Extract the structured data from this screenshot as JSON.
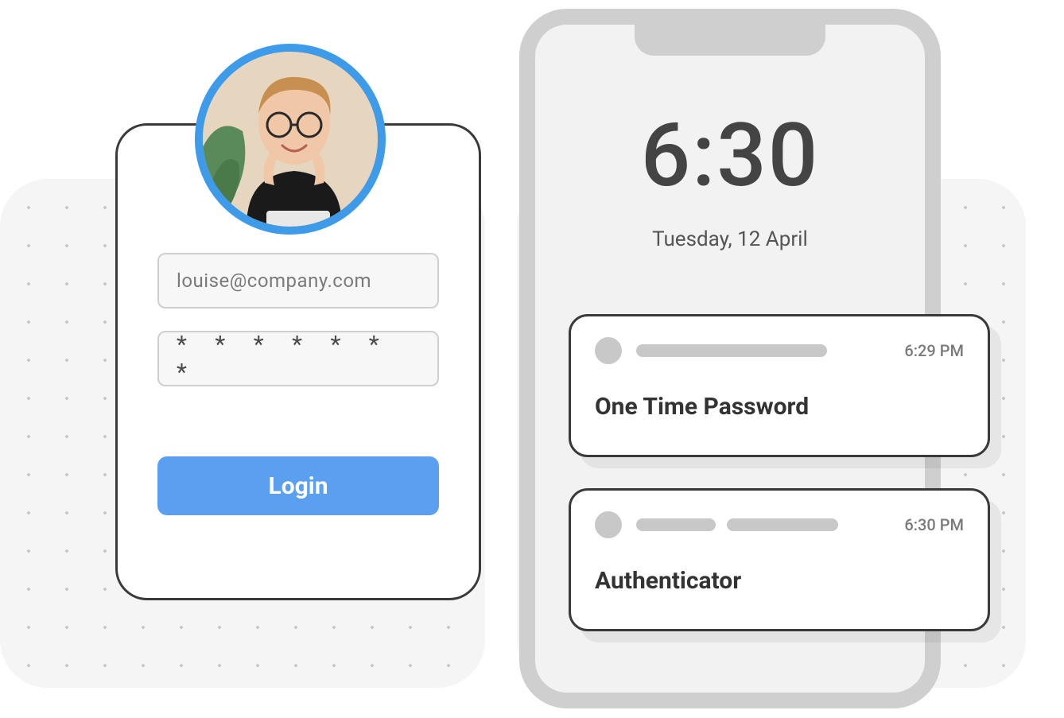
{
  "login": {
    "email_value": "louise@company.com",
    "password_display": "* * * * * * *",
    "login_label": "Login"
  },
  "phone": {
    "time": "6:30",
    "date": "Tuesday, 12 April"
  },
  "notifications": [
    {
      "title": "One Time Password",
      "time": "6:29 PM"
    },
    {
      "title": "Authenticator",
      "time": "6:30 PM"
    }
  ]
}
